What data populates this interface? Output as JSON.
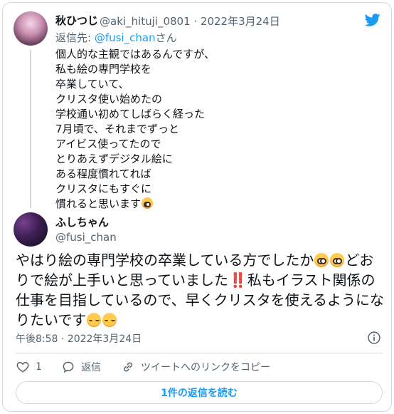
{
  "parent_tweet": {
    "author_name": "秋ひつじ",
    "handle_date": "@aki_hituji_0801 · 2022年3月24日",
    "reply_prefix": "返信先: ",
    "reply_mention": "@fusi_chan",
    "reply_suffix": "さん",
    "body": "個人的な主観ではあるんですが、\n私も絵の専門学校を\n卒業していて、\nクリスタ使い始めたの\n学校通い初めてしばらく経った\n7月頃で、それまでずっと\nアイビス使ってたので\nとりあえずデジタル絵に\nある程度慣れてれば\nクリスタにもすぐに\n慣れると思います",
    "trailing_emoji": "flushed-face"
  },
  "main_tweet": {
    "author_name": "ふしちゃん",
    "handle": "@fusi_chan",
    "text_part1": "やはり絵の専門学校の卒業している方でしたか",
    "text_part2": "どおりで絵が上手いと思っていました",
    "text_part3": "私もイラスト関係の仕事を目指しているので、早くクリスタを使えるようになりたいです",
    "bangbang": "‼️",
    "emojis": [
      "flushed-face",
      "flushed-face",
      "double-exclamation",
      "relieved-face",
      "relieved-face"
    ],
    "timestamp": "午後8:58 · 2022年3月24日"
  },
  "actions": {
    "like_count": "1",
    "reply_label": "返信",
    "copy_link_label": "ツイートへのリンクをコピー"
  },
  "read_replies_label": "1件の返信を読む",
  "colors": {
    "accent": "#1d9bf0",
    "secondary_text": "#536471",
    "border": "#cfd9de"
  }
}
